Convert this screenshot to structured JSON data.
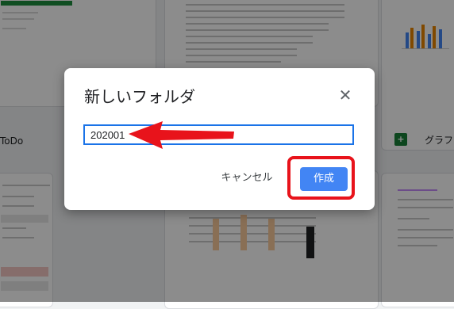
{
  "background": {
    "files": [
      {
        "title": "ToDo"
      },
      {
        "title": "グラフ"
      }
    ]
  },
  "dialog": {
    "title": "新しいフォルダ",
    "close_icon": "close-icon",
    "input_value": "202001",
    "cancel_label": "キャンセル",
    "create_label": "作成"
  },
  "colors": {
    "accent": "#4285f4",
    "highlight": "#e8131b",
    "input_border": "#1a73e8"
  }
}
